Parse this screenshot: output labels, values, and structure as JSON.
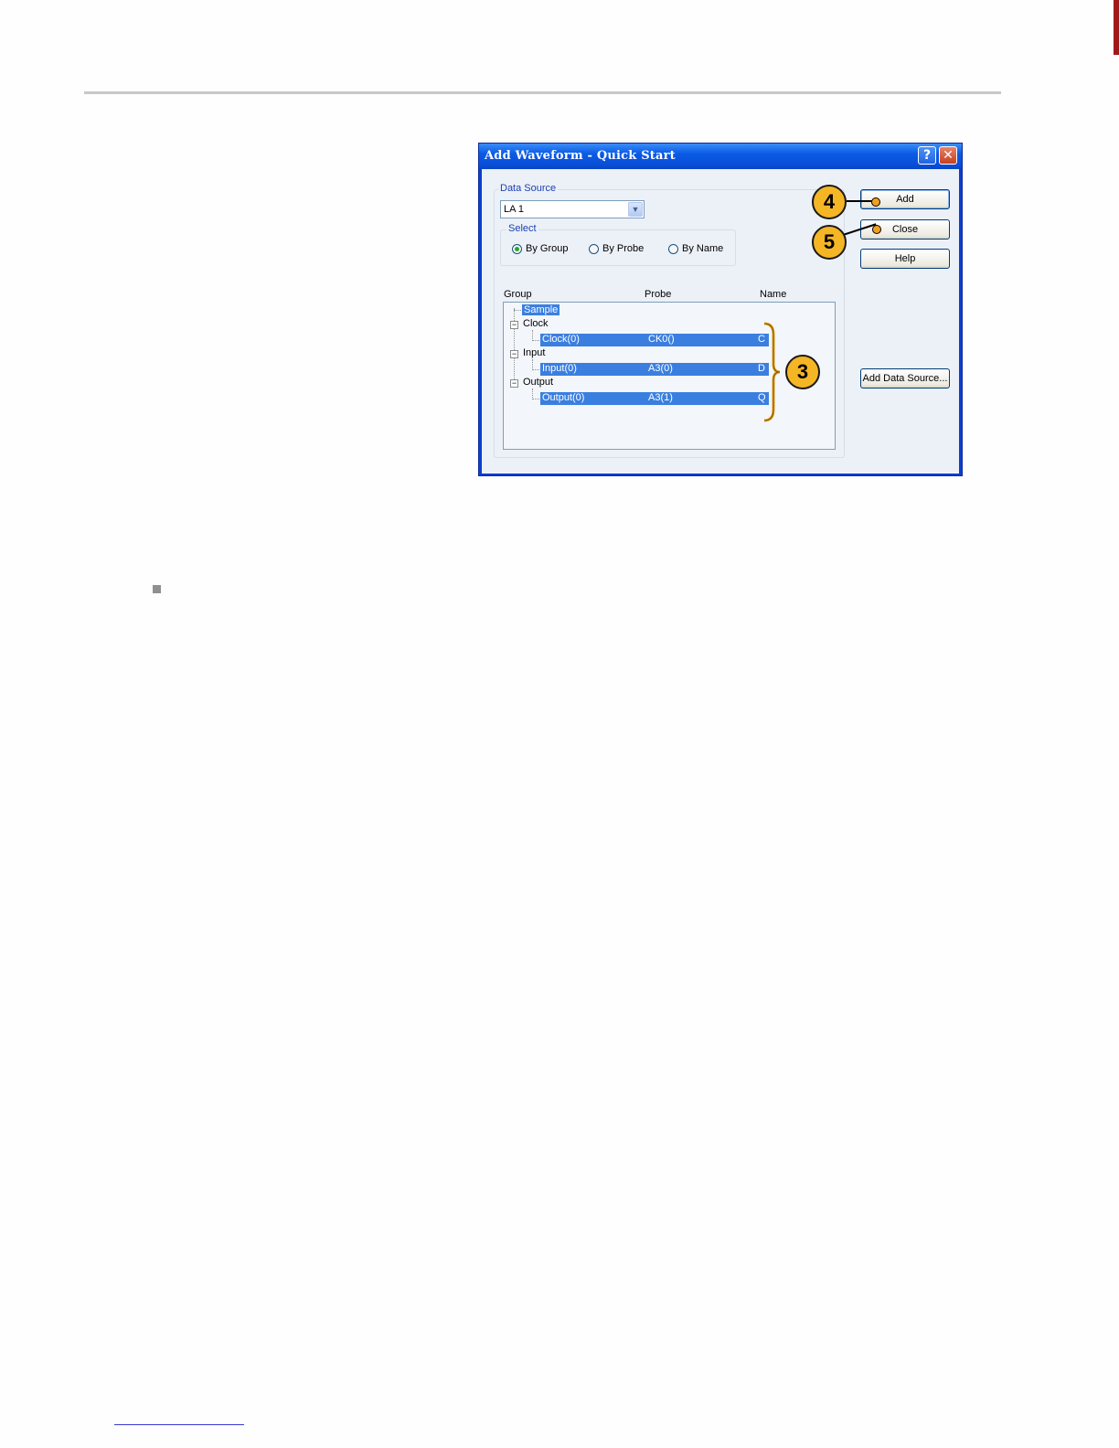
{
  "dialog": {
    "title": "Add Waveform - Quick Start",
    "help_glyph": "?",
    "close_glyph": "✕",
    "data_source": {
      "label": "Data Source",
      "value": "LA 1"
    },
    "select": {
      "label": "Select",
      "options": [
        "By Group",
        "By Probe",
        "By Name"
      ],
      "selected": "By Group"
    },
    "columns": [
      "Group",
      "Probe",
      "Name"
    ],
    "tree": {
      "sample": "Sample",
      "groups": [
        {
          "name": "Clock",
          "child": {
            "group": "Clock(0)",
            "probe": "CK0()",
            "name": "C"
          }
        },
        {
          "name": "Input",
          "child": {
            "group": "Input(0)",
            "probe": "A3(0)",
            "name": "D"
          }
        },
        {
          "name": "Output",
          "child": {
            "group": "Output(0)",
            "probe": "A3(1)",
            "name": "Q"
          }
        }
      ]
    },
    "buttons": {
      "add": "Add",
      "close": "Close",
      "help": "Help",
      "add_data_source": "Add Data Source..."
    }
  },
  "callouts": {
    "add": "4",
    "close": "5",
    "selection": "3"
  },
  "colors": {
    "title_bar": "#0a4fd8",
    "selection": "#3a7fe0",
    "callout_fill": "#f5b625",
    "page_rule": "#c8c8c8"
  }
}
